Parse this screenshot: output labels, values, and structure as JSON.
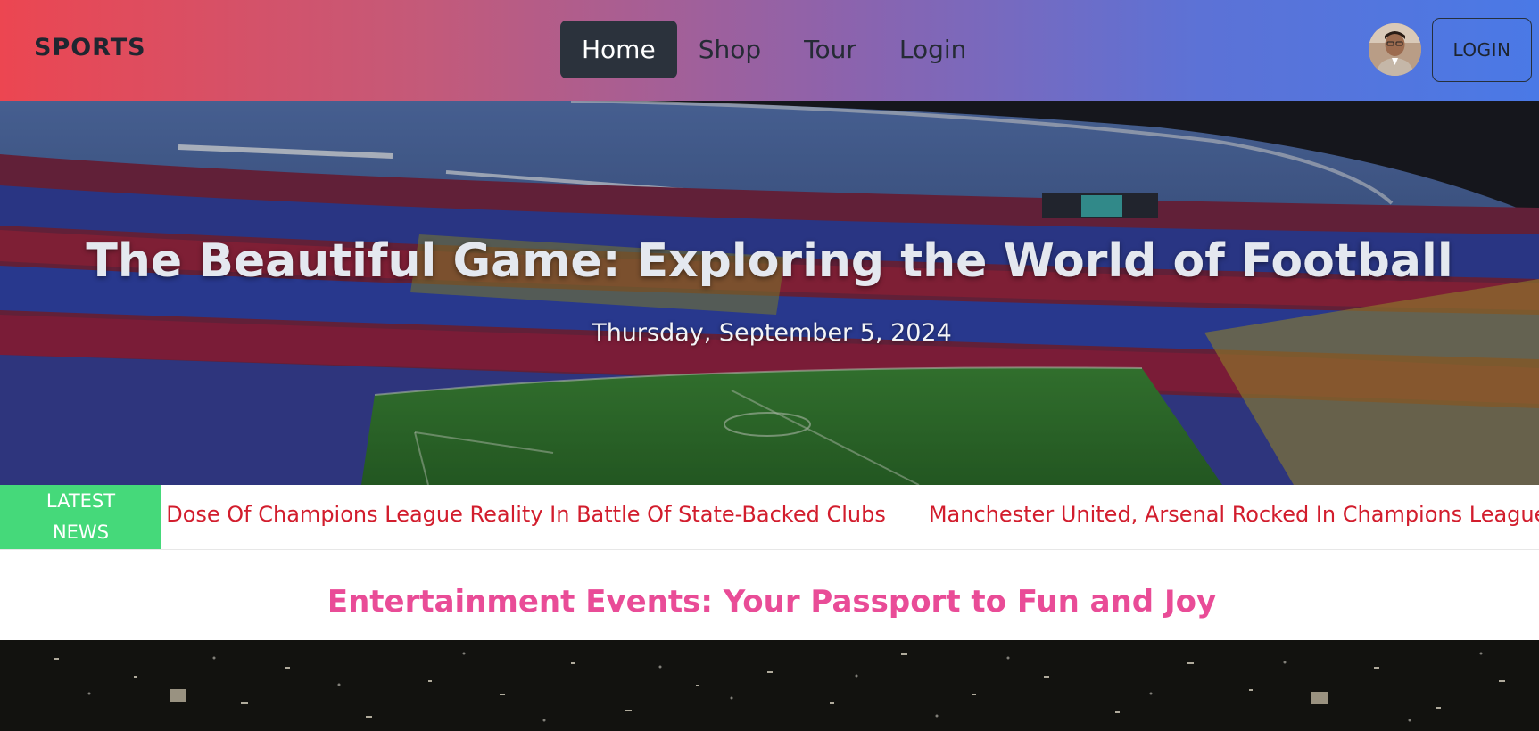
{
  "navbar": {
    "brand": "SPORTS",
    "links": [
      {
        "label": "Home",
        "active": true
      },
      {
        "label": "Shop",
        "active": false
      },
      {
        "label": "Tour",
        "active": false
      },
      {
        "label": "Login",
        "active": false
      }
    ],
    "login_button": "LOGIN",
    "gradient": [
      "#ec4651",
      "#8c63ad",
      "#4a79e6"
    ]
  },
  "hero": {
    "title": "The Beautiful Game: Exploring the World of Football",
    "date": "Thursday, September 5, 2024"
  },
  "ticker": {
    "label_line1": "LATEST",
    "label_line2": "NEWS",
    "items": [
      "G Dose Of Champions League Reality In Battle Of State-Backed Clubs",
      "Manchester United, Arsenal Rocked In Champions League A"
    ],
    "label_color": "#45d97a",
    "text_color": "#d21d2d"
  },
  "section": {
    "heading": "Entertainment Events: Your Passport to Fun and Joy",
    "heading_color": "#e94c97"
  }
}
